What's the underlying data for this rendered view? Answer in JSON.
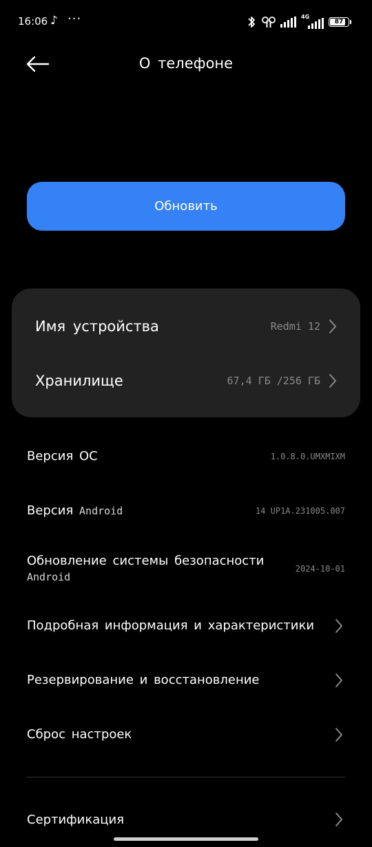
{
  "status_bar": {
    "time": "16:06",
    "note_icon": "music-note-icon",
    "dots": "···",
    "network": "4G",
    "battery": "87",
    "battery_level": 0.87
  },
  "header": {
    "title": "О телефоне",
    "back_icon": "arrow-left-icon"
  },
  "update_button": {
    "label": "Обновить",
    "color": "#3482f6"
  },
  "card": {
    "device_name": {
      "label": "Имя устройства",
      "value": "Redmi 12"
    },
    "storage": {
      "label": "Хранилище",
      "value": "67,4 ГБ /256 ГБ"
    }
  },
  "rows": {
    "os_version": {
      "label": "Версия ОС",
      "value": "1.0.8.0.UMXMIXM"
    },
    "android_version": {
      "label": "Версия",
      "label_suffix": "Android",
      "value": "14 UP1A.231005.007"
    },
    "security_update": {
      "label": "Обновление системы безопасности",
      "sub": "Android",
      "value": "2024-10-01"
    },
    "specs": {
      "label": "Подробная информация и характеристики"
    },
    "backup": {
      "label": "Резервирование и восстановление"
    },
    "reset": {
      "label": "Сброс настроек"
    },
    "certification": {
      "label": "Сертификация"
    }
  }
}
